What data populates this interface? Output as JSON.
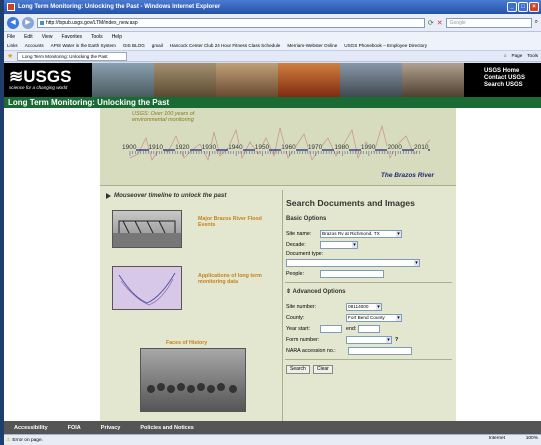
{
  "window": {
    "title": "Long Term Monitoring: Unlocking the Past - Windows Internet Explorer"
  },
  "address": {
    "url": "http://txpub.usgs.gov/LTM/index_new.asp",
    "search_placeholder": "Google"
  },
  "menu": [
    "File",
    "Edit",
    "View",
    "Favorites",
    "Tools",
    "Help"
  ],
  "links": [
    "Links",
    "Accounts",
    "APIS Water in the Earth System",
    "GIS BLOG",
    "gmail",
    "Hancock Center Club 24 Hour Fitness Class Schedule",
    "Merriam-Webster Online",
    "USGS Phonebook – Employee Directory"
  ],
  "tab": {
    "label": "Long Term Monitoring: Unlocking the Past",
    "page": "Page",
    "tools": "Tools"
  },
  "site": {
    "logo": "≋USGS",
    "tagline": "science for a changing world",
    "top_links": [
      "USGS Home",
      "Contact USGS",
      "Search USGS"
    ],
    "heading": "Long Term Monitoring: Unlocking the Past"
  },
  "timeline": {
    "caption": "USGS: Over 100 years of environmental monitoring",
    "years": [
      "1900",
      "1910",
      "1920",
      "1930",
      "1940",
      "1950",
      "1960",
      "1970",
      "1980",
      "1990",
      "2000",
      "2010"
    ],
    "river": "The Brazos River"
  },
  "left": {
    "mouseover": "Mouseover timeline to unlock the past",
    "flood": "Major Brazos River Flood Events",
    "apps": "Applications of long term monitoring data",
    "faces": "Faces of History"
  },
  "search": {
    "title": "Search Documents and Images",
    "basic": "Basic Options",
    "site_label": "Site name:",
    "site_value": "Brazos Rv at Richmond, TX",
    "decade_label": "Decade:",
    "doctype_label": "Document type:",
    "people_label": "People:",
    "advanced": "Advanced Options",
    "sitenum_label": "Site number:",
    "sitenum_value": "08114000",
    "county_label": "County:",
    "county_value": "Fort Bend County",
    "yearstart_label": "Year start:",
    "end_label": "end:",
    "form_label": "Form number:",
    "form_help": "?",
    "nara_label": "NARA accession no.:",
    "search_btn": "Search",
    "clear_btn": "Clear"
  },
  "footer": [
    "Accessibility",
    "FOIA",
    "Privacy",
    "Policies and Notices"
  ],
  "status": {
    "text": "Error on page.",
    "zone": "Internet",
    "zoom": "100%"
  }
}
